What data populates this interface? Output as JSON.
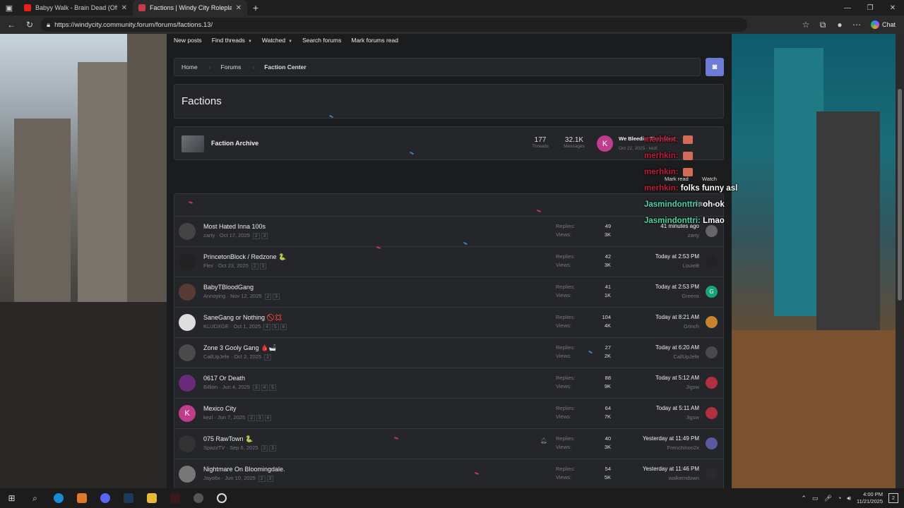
{
  "tabs": [
    {
      "title": "Babyy Walk - Brain Dead (Officia",
      "favicon_color": "#e62117",
      "active": false
    },
    {
      "title": "Factions | Windy City Roleplay",
      "favicon_color": "#c43b4b",
      "active": true
    }
  ],
  "url": "https://windycity.community.forum/forums/factions.13/",
  "chat_label": "Chat",
  "subnav": {
    "new_posts": "New posts",
    "find_threads": "Find threads",
    "watched": "Watched",
    "search_forums": "Search forums",
    "mark_read": "Mark forums read"
  },
  "breadcrumb": {
    "home": "Home",
    "forums": "Forums",
    "current": "Faction Center"
  },
  "page_title": "Factions",
  "archive": {
    "title": "Faction Archive",
    "threads": "177",
    "threads_label": "Threads",
    "messages": "32.1K",
    "messages_label": "Messages",
    "avatar_letter": "K",
    "latest_title": "We Bleedin' They Meat",
    "latest_meta": "Oct 22, 2025 · kezl"
  },
  "list": {
    "filters": "Filters",
    "replies_label": "Replies:",
    "views_label": "Views:"
  },
  "threads": [
    {
      "title": "Most Hated Inna 100s",
      "meta": "zarty · Oct 17, 2025",
      "pages": [
        "2",
        "3"
      ],
      "replies": "49",
      "views": "3K",
      "last_time": "41 minutes ago",
      "last_user": "zarty",
      "av_color": "#444",
      "av_letter": "",
      "mini_color": "#666",
      "mini_letter": ""
    },
    {
      "title": "PrincetonBlock / Redzone 🐍",
      "meta": "Flex · Oct 23, 2025",
      "pages": [
        "2",
        "3"
      ],
      "replies": "42",
      "views": "3K",
      "last_time": "Today at 2:53 PM",
      "last_user": "LouieB",
      "av_color": "#222",
      "av_letter": "",
      "mini_color": "#222",
      "mini_letter": ""
    },
    {
      "title": "BabyTBloodGang",
      "meta": "Annoying · Nov 12, 2025",
      "pages": [
        "2",
        "3"
      ],
      "replies": "41",
      "views": "1K",
      "last_time": "Today at 2:53 PM",
      "last_user": "Greens",
      "av_color": "#5a3a34",
      "av_letter": "",
      "mini_color": "#1aa37a",
      "mini_letter": "G"
    },
    {
      "title": "SaneGang or Nothing 🚫💢",
      "meta": "KLUDXGE · Oct 1, 2025",
      "pages": [
        "4",
        "5",
        "6"
      ],
      "replies": "104",
      "views": "4K",
      "last_time": "Today at 8:21 AM",
      "last_user": "Grinch",
      "av_color": "#ddd",
      "av_letter": "",
      "mini_color": "#c9822f",
      "mini_letter": ""
    },
    {
      "title": "Zone 3 Gooly Gang 🩸🛁",
      "meta": "CallUpJefe · Oct 2, 2025",
      "pages": [
        "2"
      ],
      "replies": "27",
      "views": "2K",
      "last_time": "Today at 6:20 AM",
      "last_user": "CallUpJefe",
      "av_color": "#4a4a4a",
      "av_letter": "",
      "mini_color": "#4a4a4a",
      "mini_letter": ""
    },
    {
      "title": "0617 Or Death",
      "meta": "Billion · Jun 4, 2025",
      "pages": [
        "3",
        "4",
        "5"
      ],
      "replies": "88",
      "views": "9K",
      "last_time": "Today at 5:12 AM",
      "last_user": "Jigsw",
      "av_color": "#6a2a7a",
      "av_letter": "",
      "mini_color": "#b03040",
      "mini_letter": ""
    },
    {
      "title": "Mexico City",
      "meta": "kezl · Jun 7, 2025",
      "pages": [
        "2",
        "3",
        "4"
      ],
      "replies": "64",
      "views": "7K",
      "last_time": "Today at 5:11 AM",
      "last_user": "Jigsw",
      "av_color": "#c03d8e",
      "av_letter": "K",
      "mini_color": "#b03040",
      "mini_letter": ""
    },
    {
      "title": "075 RawTown 🐍",
      "meta": "SpazzTV · Sep 6, 2025",
      "pages": [
        "2",
        "3"
      ],
      "replies": "40",
      "views": "3K",
      "last_time": "Yesterday at 11:49 PM",
      "last_user": "Frenchinoo2x",
      "av_color": "#333",
      "av_letter": "",
      "mini_color": "#5a5aa0",
      "mini_letter": ""
    },
    {
      "title": "Nightmare On Bloomingdale.",
      "meta": "Jayo6x · Jun 10, 2025",
      "pages": [
        "2",
        "3"
      ],
      "replies": "54",
      "views": "5K",
      "last_time": "Yesterday at 11:46 PM",
      "last_user": "walkemdown",
      "av_color": "#777",
      "av_letter": "",
      "mini_color": "#2a2a2a",
      "mini_letter": ""
    }
  ],
  "chat_overlay": [
    {
      "user": "merhkin:",
      "msg": "",
      "color": "red",
      "emote": true
    },
    {
      "user": "merhkin:",
      "msg": "",
      "color": "red",
      "emote": true
    },
    {
      "user": "merhkin:",
      "msg": "",
      "color": "red",
      "emote": true
    },
    {
      "user": "merhkin:",
      "msg": "folks funny asl",
      "color": "red",
      "emote": false
    },
    {
      "user": "Jasmindonttri:",
      "msg": "oh ok",
      "color": "green",
      "emote": false
    },
    {
      "user": "Jasmindonttri:",
      "msg": "Lmao",
      "color": "green",
      "emote": false
    }
  ],
  "list_actions": {
    "mark_read": "Mark read",
    "watch": "Watch"
  },
  "clock": {
    "time": "4:00 PM",
    "date": "11/21/2025"
  },
  "notifications": "2"
}
